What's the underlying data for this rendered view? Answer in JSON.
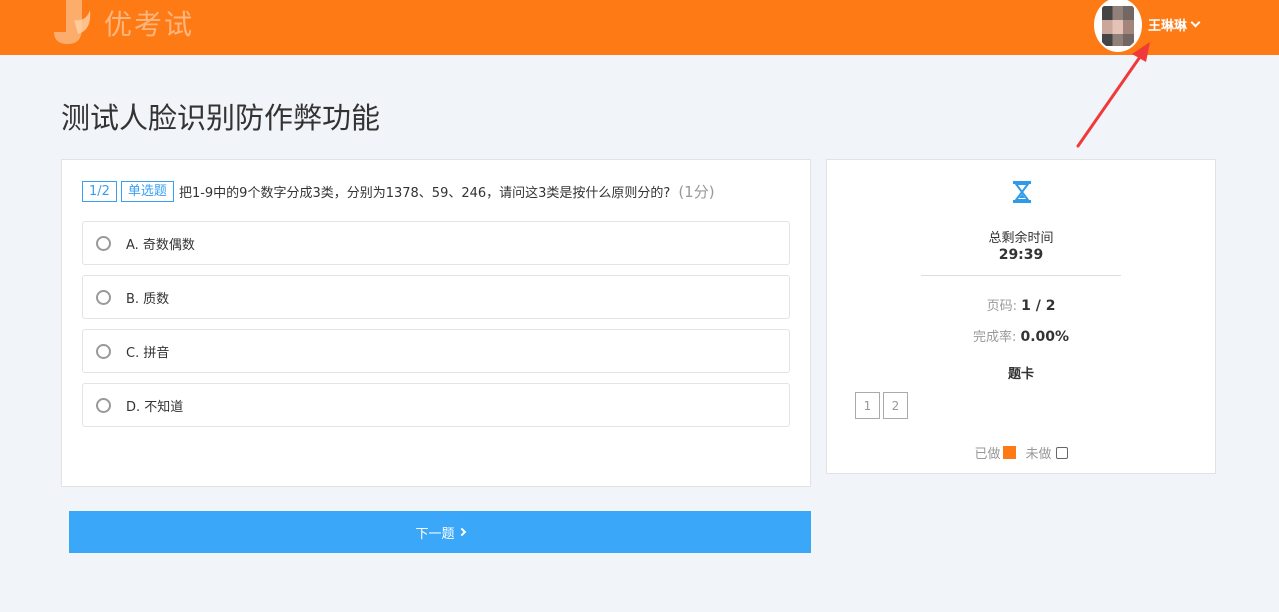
{
  "header": {
    "logo_text": "优考试",
    "user_name": "王琳琳",
    "brand_color": "#fd7a15"
  },
  "exam": {
    "title": "测试人脸识别防作弊功能"
  },
  "question": {
    "number_tag": "1/2",
    "type_tag": "单选题",
    "text": "把1-9中的9个数字分成3类，分别为1378、59、246，请问这3类是按什么原则分的?",
    "score": "(1分)",
    "options": [
      {
        "label": "A. 奇数偶数"
      },
      {
        "label": "B. 质数"
      },
      {
        "label": "C. 拼音"
      },
      {
        "label": "D. 不知道"
      }
    ]
  },
  "next_button": {
    "label": "下一题",
    "color": "#3aa7f8"
  },
  "sidebar": {
    "time_label": "总剩余时间",
    "time_value": "29:39",
    "page_label": "页码:",
    "page_value": "1 / 2",
    "completion_label": "完成率:",
    "completion_value": "0.00%",
    "card_title": "题卡",
    "question_cells": [
      "1",
      "2"
    ],
    "legend_done": "已做",
    "legend_todo": "未做"
  },
  "icons": {
    "hourglass": "hourglass-icon",
    "chevron": "chevron-down-icon",
    "arrow": "red-annotation-arrow"
  }
}
